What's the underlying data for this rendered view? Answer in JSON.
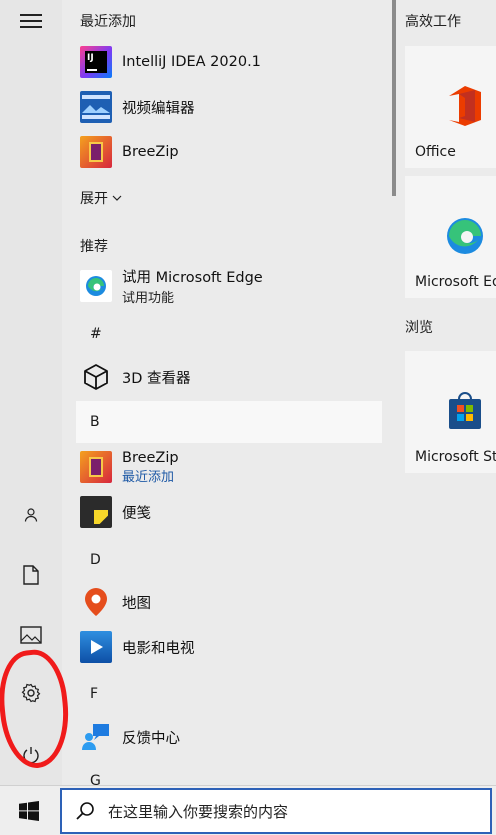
{
  "recent": {
    "header": "最近添加",
    "items": [
      {
        "name": "IntelliJ IDEA 2020.1",
        "icon": "intellij-icon"
      },
      {
        "name": "视频编辑器",
        "icon": "video-editor-icon"
      },
      {
        "name": "BreeZip",
        "icon": "breezip-icon"
      }
    ],
    "expand_label": "展开"
  },
  "recommended": {
    "header": "推荐",
    "item": {
      "name": "试用 Microsoft Edge",
      "sub": "试用功能",
      "icon": "edge-icon"
    }
  },
  "alpha": {
    "hash": "#",
    "viewer3d": "3D 查看器",
    "b": "B",
    "breezip_name": "BreeZip",
    "breezip_sub": "最近添加",
    "sticky": "便笺",
    "d": "D",
    "maps": "地图",
    "movies": "电影和电视",
    "f": "F",
    "feedback": "反馈中心",
    "g": "G"
  },
  "tiles": {
    "group1": "高效工作",
    "office": "Office",
    "edge": "Microsoft Edge",
    "group2": "浏览",
    "store": "Microsoft Store"
  },
  "search": {
    "placeholder": "在这里输入你要搜索的内容"
  }
}
